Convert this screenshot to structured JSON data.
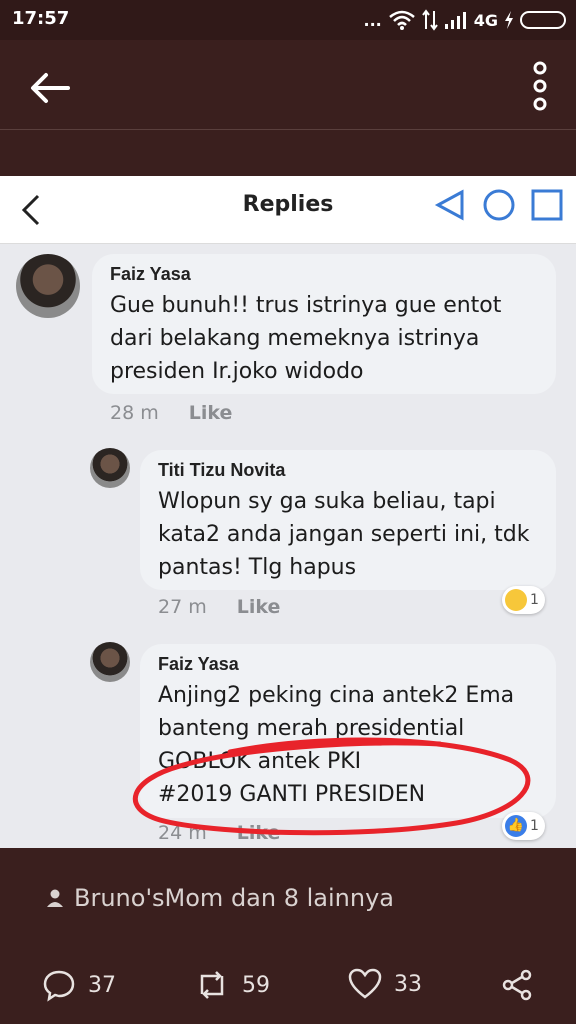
{
  "status_bar": {
    "time": "17:57",
    "dots": "...",
    "network": "4G"
  },
  "app_bar": {
    "back_icon": "arrow-left-icon",
    "more_icon": "vertical-dots-icon"
  },
  "screenshot": {
    "title": "Replies",
    "comments": [
      {
        "author": "Faiz Yasa",
        "text": "Gue bunuh!! trus istrinya gue entot dari belakang memeknya istrinya presiden Ir.joko widodo",
        "lines": [
          "Gue bunuh!! trus istrinya gue entot",
          "dari belakang memeknya istrinya",
          "presiden Ir.joko widodo"
        ],
        "time": "28 m",
        "like": "Like"
      },
      {
        "author": "Titi Tizu Novita",
        "lines": [
          "Wlopun sy ga suka beliau, tapi",
          "kata2 anda jangan seperti ini, tdk",
          "pantas! Tlg hapus"
        ],
        "time": "27 m",
        "like": "Like",
        "reaction_count": "1"
      },
      {
        "author": "Faiz Yasa",
        "lines": [
          "Anjing2 peking cina antek2 Ema",
          "banteng merah presidential",
          "GOBLOK antek PKI",
          "#2019 GANTI PRESIDEN"
        ],
        "time": "24 m",
        "like": "Like",
        "reaction_count": "1"
      }
    ]
  },
  "likes_line": "Bruno'sMom dan 8 lainnya",
  "actions": {
    "comments": "37",
    "retweets": "59",
    "likes": "33"
  },
  "colors": {
    "background": "#3a1f1e",
    "scribble": "#e8232a",
    "facebook_blue": "#3b7ee8"
  }
}
